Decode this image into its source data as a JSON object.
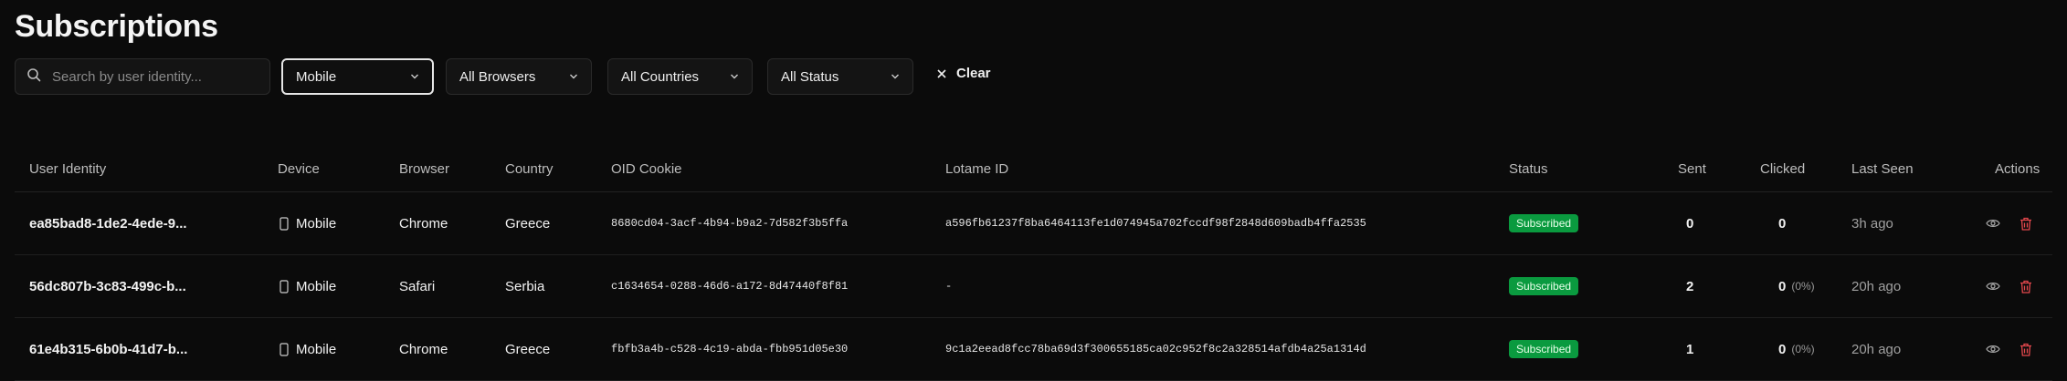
{
  "page": {
    "title": "Subscriptions"
  },
  "filters": {
    "search_placeholder": "Search by user identity...",
    "device": "Mobile",
    "browser": "All Browsers",
    "country": "All Countries",
    "status": "All Status",
    "clear_label": "Clear"
  },
  "table": {
    "headers": {
      "identity": "User Identity",
      "device": "Device",
      "browser": "Browser",
      "country": "Country",
      "oid": "OID Cookie",
      "lotame": "Lotame ID",
      "status": "Status",
      "sent": "Sent",
      "clicked": "Clicked",
      "last_seen": "Last Seen",
      "actions": "Actions"
    },
    "rows": [
      {
        "identity": "ea85bad8-1de2-4ede-9...",
        "device": "Mobile",
        "browser": "Chrome",
        "country": "Greece",
        "oid": "8680cd04-3acf-4b94-b9a2-7d582f3b5ffa",
        "lotame": "a596fb61237f8ba6464113fe1d074945a702fccdf98f2848d609badb4ffa2535",
        "status": "Subscribed",
        "sent": "0",
        "clicked": "0",
        "clicked_pct": "",
        "last_seen": "3h ago"
      },
      {
        "identity": "56dc807b-3c83-499c-b...",
        "device": "Mobile",
        "browser": "Safari",
        "country": "Serbia",
        "oid": "c1634654-0288-46d6-a172-8d47440f8f81",
        "lotame": "-",
        "status": "Subscribed",
        "sent": "2",
        "clicked": "0",
        "clicked_pct": "(0%)",
        "last_seen": "20h ago"
      },
      {
        "identity": "61e4b315-6b0b-41d7-b...",
        "device": "Mobile",
        "browser": "Chrome",
        "country": "Greece",
        "oid": "fbfb3a4b-c528-4c19-abda-fbb951d05e30",
        "lotame": "9c1a2eead8fcc78ba69d3f300655185ca02c952f8c2a328514afdb4a25a1314d",
        "status": "Subscribed",
        "sent": "1",
        "clicked": "0",
        "clicked_pct": "(0%)",
        "last_seen": "20h ago"
      }
    ]
  },
  "icons": {
    "search": "search-icon",
    "chevron": "chevron-down-icon",
    "clear": "close-icon",
    "device": "smartphone-icon",
    "view": "eye-icon",
    "delete": "trash-icon"
  },
  "colors": {
    "background": "#0b0b0b",
    "badge_green": "#0a9a3f",
    "delete_red": "#e5484d"
  }
}
